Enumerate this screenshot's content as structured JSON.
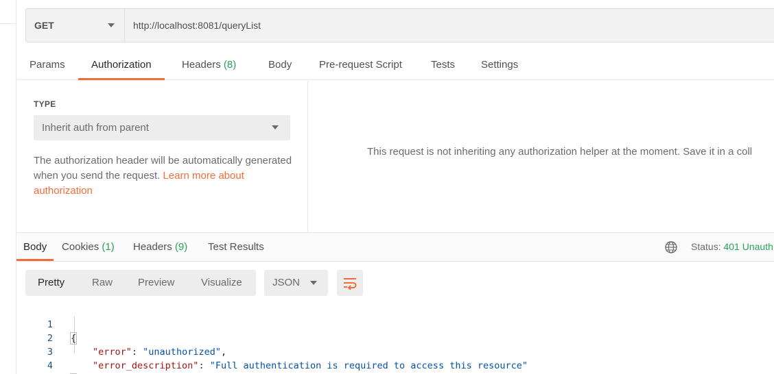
{
  "request": {
    "method": "GET",
    "url": "http://localhost:8081/queryList"
  },
  "request_tabs": [
    {
      "label": "Params"
    },
    {
      "label": "Authorization",
      "active": true
    },
    {
      "label": "Headers",
      "count": "(8)"
    },
    {
      "label": "Body"
    },
    {
      "label": "Pre-request Script"
    },
    {
      "label": "Tests"
    },
    {
      "label": "Settings"
    }
  ],
  "auth": {
    "type_label": "TYPE",
    "type_value": "Inherit auth from parent",
    "description": "The authorization header will be automatically generated when you send the request. ",
    "learn_more": "Learn more about authorization",
    "info_text": "This request is not inheriting any authorization helper at the moment. Save it in a coll"
  },
  "response_tabs": [
    {
      "label": "Body",
      "active": true
    },
    {
      "label": "Cookies",
      "count": "(1)"
    },
    {
      "label": "Headers",
      "count": "(9)"
    },
    {
      "label": "Test Results"
    }
  ],
  "status": {
    "label": "Status:",
    "value": "401 Unauth"
  },
  "body_view": {
    "modes": [
      "Pretty",
      "Raw",
      "Preview",
      "Visualize"
    ],
    "active_mode": "Pretty",
    "format": "JSON"
  },
  "response_body": {
    "lines": [
      {
        "num": "1"
      },
      {
        "num": "2",
        "key": "\"error\"",
        "value": "\"unauthorized\""
      },
      {
        "num": "3",
        "key": "\"error_description\"",
        "value": "\"Full authentication is required to access this resource\""
      },
      {
        "num": "4"
      }
    ],
    "open_brace": "{",
    "close_brace": "}",
    "colon": ": ",
    "comma": ","
  },
  "colors": {
    "accent": "#f26b3a",
    "success": "#26a35a"
  },
  "icons": {
    "method_dropdown": "chevron-down-icon",
    "globe": "globe-icon",
    "wrap": "wrap-lines-icon"
  }
}
